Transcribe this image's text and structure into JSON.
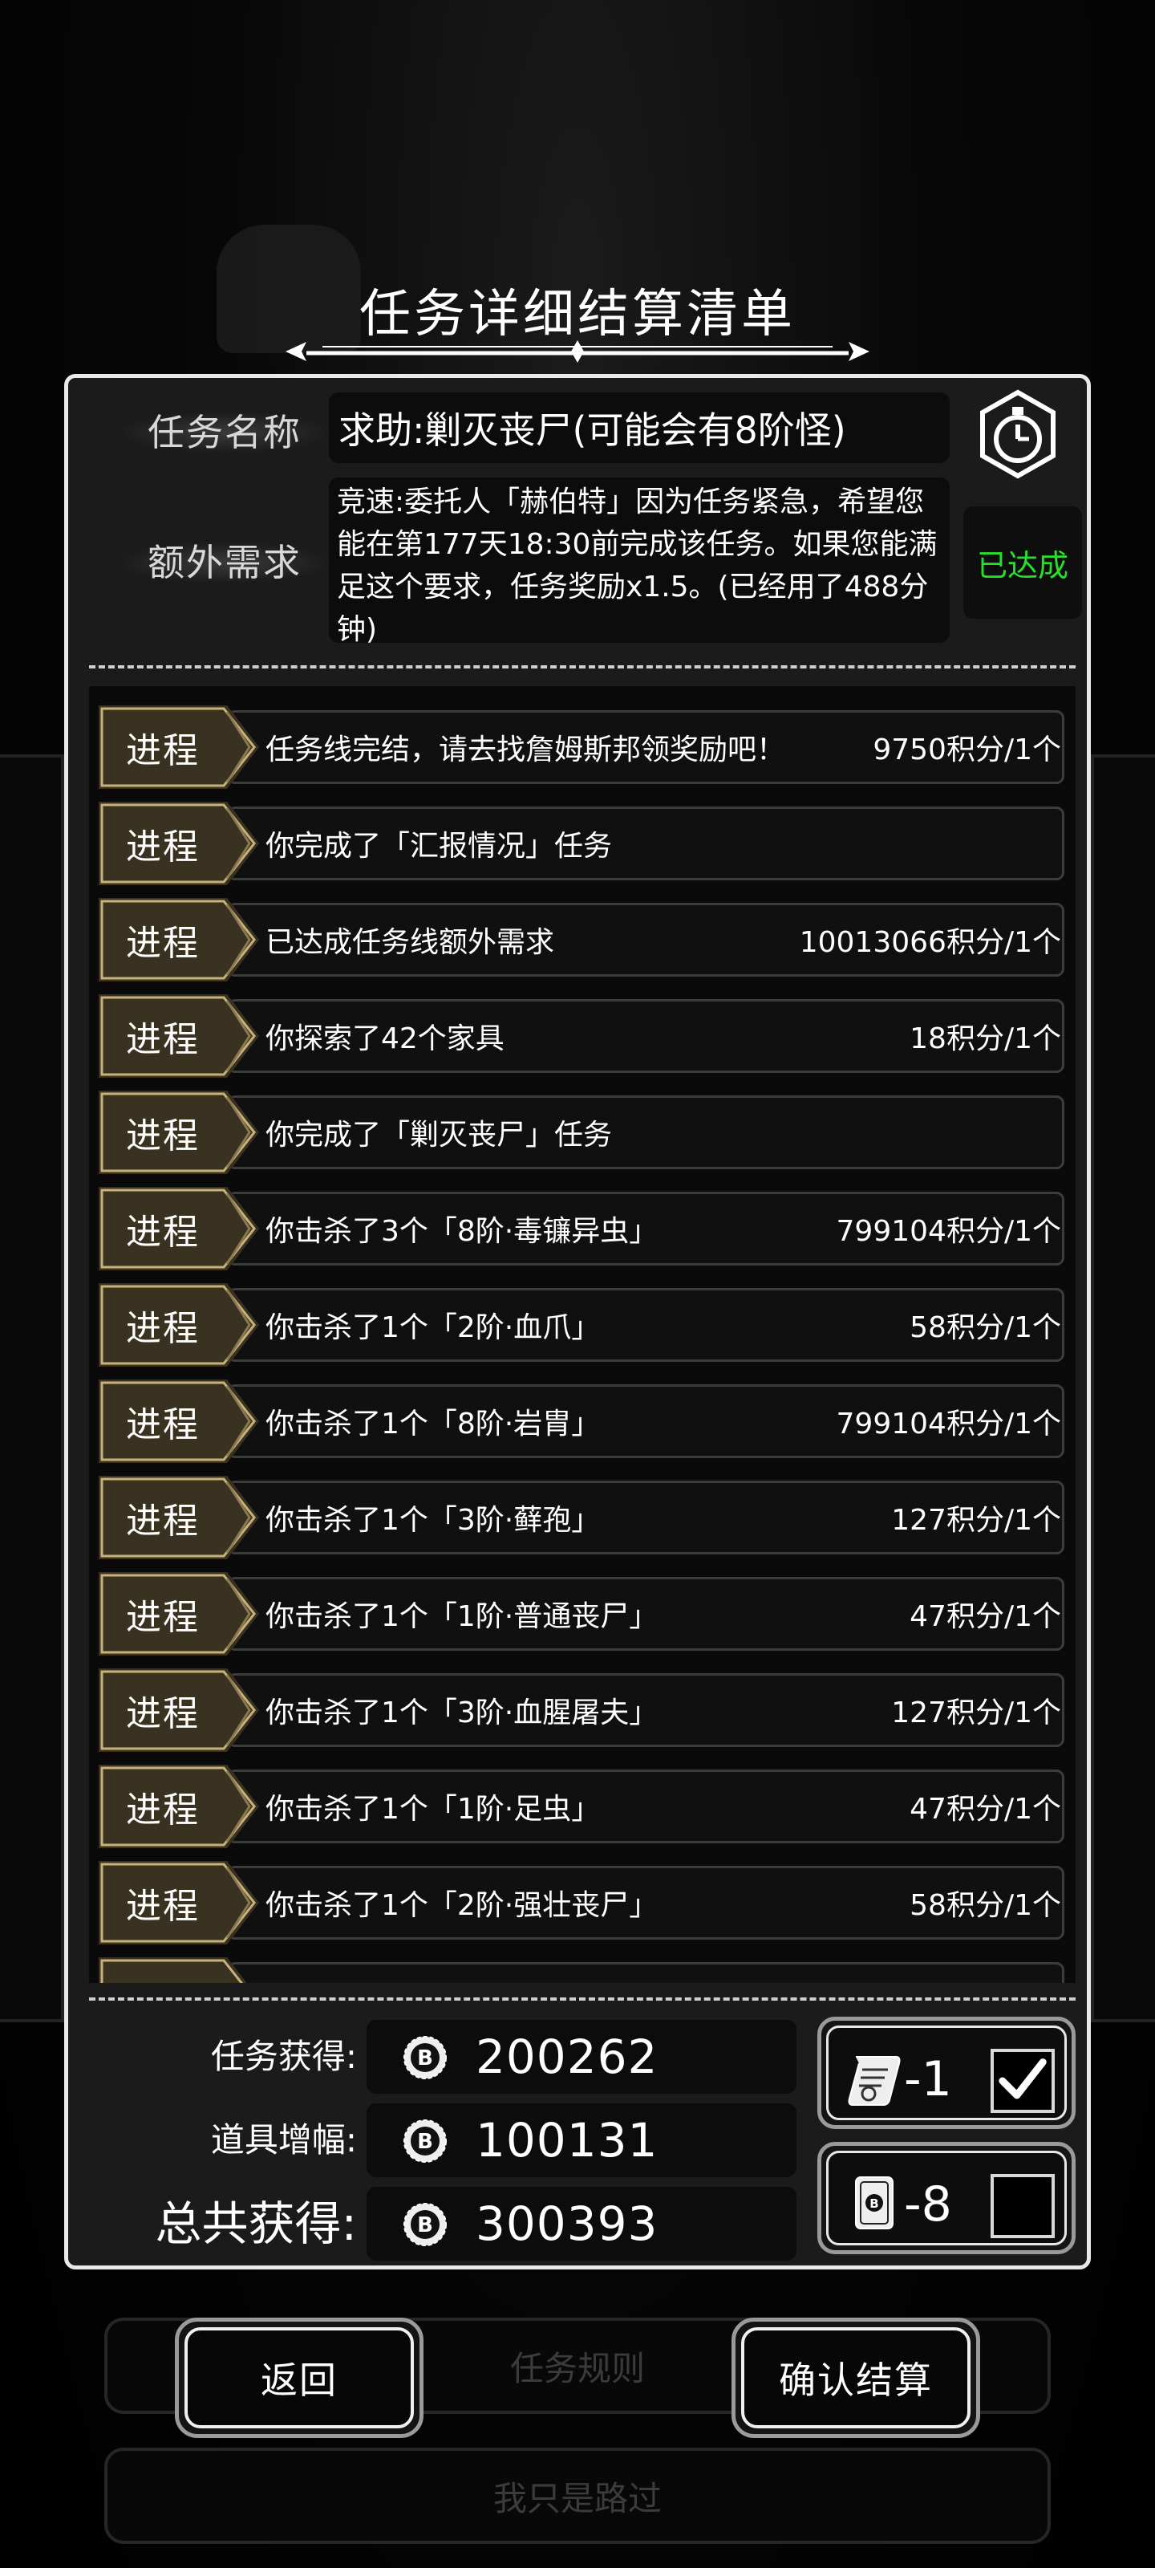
{
  "title": "任务详细结算清单",
  "task_name_label": "任务名称",
  "task_name_value": "求助:剿灭丧尸(可能会有8阶怪)",
  "extra_req_label": "额外需求",
  "extra_req_text": "竞速:委托人「赫伯特」因为任务紧急，希望您能在第177天18:30前完成该任务。如果您能满足这个要求，任务奖励x1.5。(已经用了488分钟)",
  "extra_req_status": "已达成",
  "progress_rows": [
    {
      "tag": "进程",
      "desc": "任务线完结，请去找詹姆斯邦领奖励吧！",
      "points": "9750积分/1个"
    },
    {
      "tag": "进程",
      "desc": "你完成了「汇报情况」任务",
      "points": ""
    },
    {
      "tag": "进程",
      "desc": "已达成任务线额外需求",
      "points": "10013066积分/1个"
    },
    {
      "tag": "进程",
      "desc": "你探索了42个家具",
      "points": "18积分/1个"
    },
    {
      "tag": "进程",
      "desc": "你完成了「剿灭丧尸」任务",
      "points": ""
    },
    {
      "tag": "进程",
      "desc": "你击杀了3个「8阶·毒镰异虫」",
      "points": "799104积分/1个"
    },
    {
      "tag": "进程",
      "desc": "你击杀了1个「2阶·血爪」",
      "points": "58积分/1个"
    },
    {
      "tag": "进程",
      "desc": "你击杀了1个「8阶·岩胄」",
      "points": "799104积分/1个"
    },
    {
      "tag": "进程",
      "desc": "你击杀了1个「3阶·藓孢」",
      "points": "127积分/1个"
    },
    {
      "tag": "进程",
      "desc": "你击杀了1个「1阶·普通丧尸」",
      "points": "47积分/1个"
    },
    {
      "tag": "进程",
      "desc": "你击杀了1个「3阶·血腥屠夫」",
      "points": "127积分/1个"
    },
    {
      "tag": "进程",
      "desc": "你击杀了1个「1阶·足虫」",
      "points": "47积分/1个"
    },
    {
      "tag": "进程",
      "desc": "你击杀了1个「2阶·强壮丧尸」",
      "points": "58积分/1个"
    }
  ],
  "totals": {
    "task_label": "任务获得:",
    "task_value": "200262",
    "item_label": "道具增幅:",
    "item_value": "100131",
    "total_label": "总共获得:",
    "total_value": "300393"
  },
  "options": [
    {
      "icon": "scroll-icon",
      "value": "-1",
      "checked": true
    },
    {
      "icon": "card-icon",
      "value": "-8",
      "checked": false
    }
  ],
  "background": {
    "rules_button": "任务规则",
    "pass_button": "我只是路过"
  },
  "buttons": {
    "back": "返回",
    "confirm": "确认结算"
  },
  "colors": {
    "status_green": "#28e02a",
    "tag_gold": "#c9b27a",
    "tag_fill": "#3a3220"
  }
}
